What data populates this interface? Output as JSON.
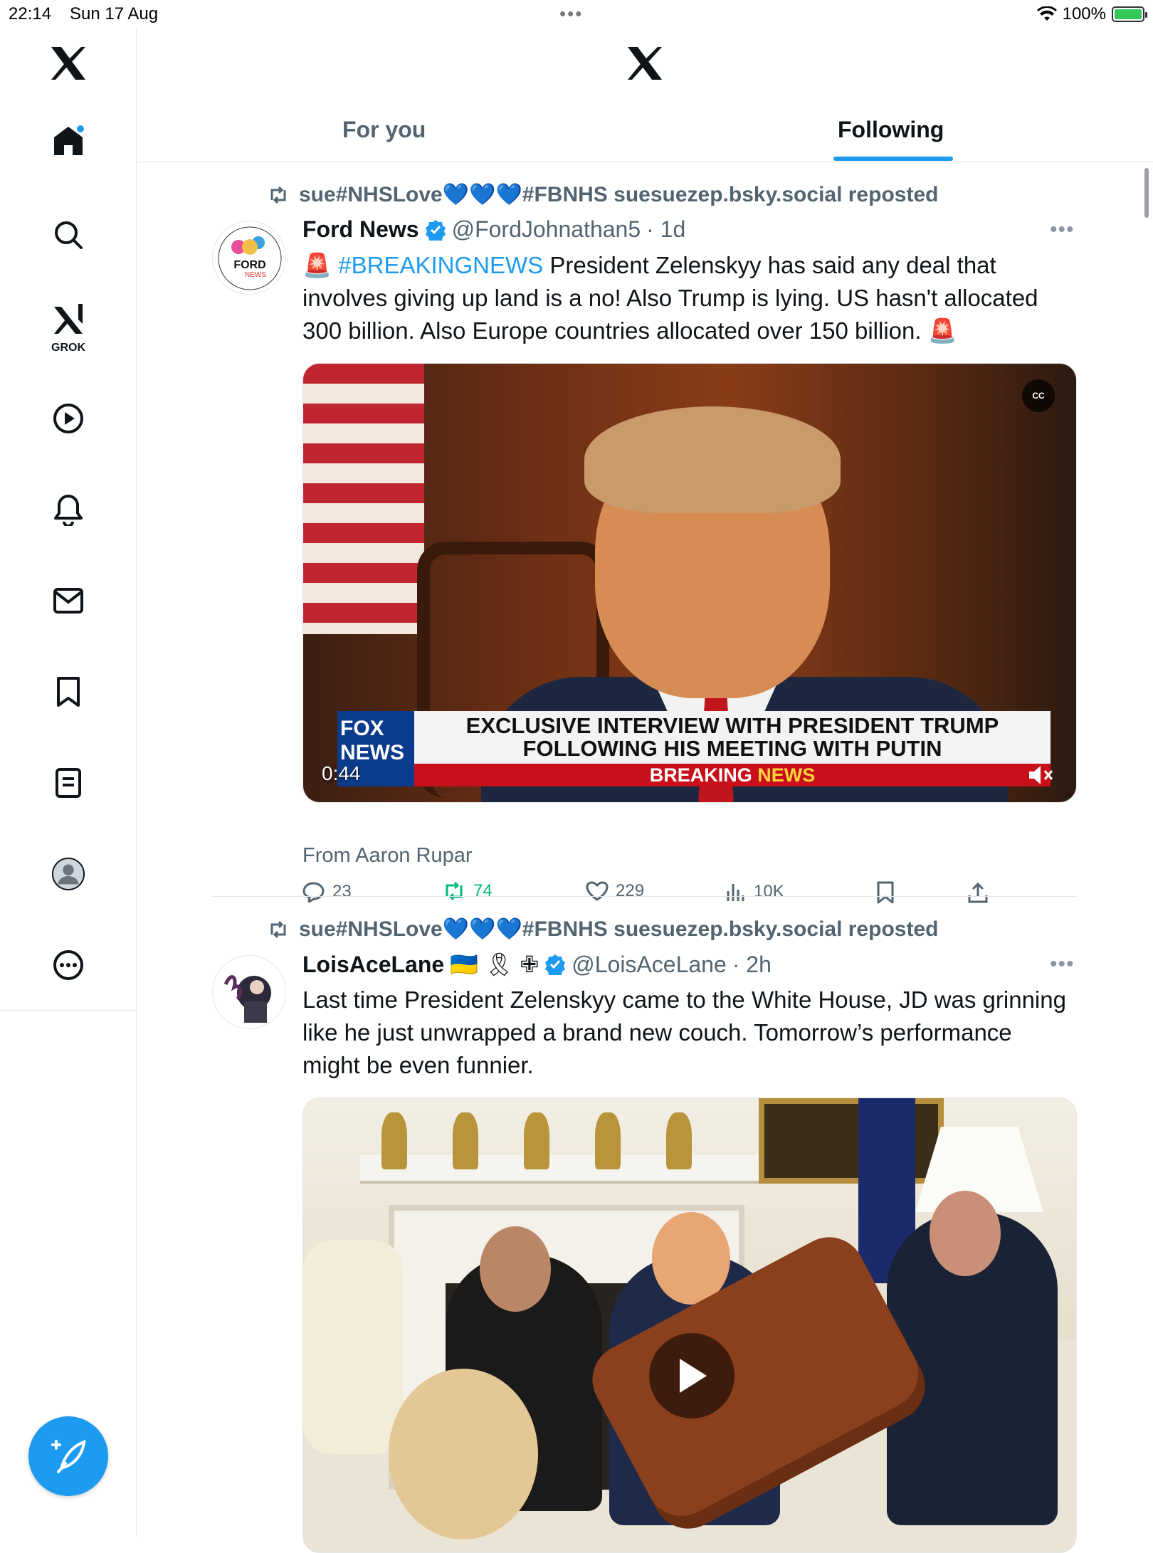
{
  "status_bar": {
    "time": "22:14",
    "date": "Sun 17 Aug",
    "battery": "100%"
  },
  "tabs": [
    {
      "label": "For you",
      "active": false
    },
    {
      "label": "Following",
      "active": true
    }
  ],
  "sidebar": {
    "grok_label": "GROK",
    "items": [
      "home-icon",
      "search-icon",
      "grok-icon",
      "video-icon",
      "notifications-bell-icon",
      "messages-envelope-icon",
      "bookmarks-icon",
      "lists-icon",
      "profile-avatar-icon",
      "more-icon"
    ]
  },
  "tweets": [
    {
      "repost_text": "sue#NHSLove💙💙💙#FBNHS suesuezep.bsky.social reposted",
      "name": "Ford News",
      "handle": "@FordJohnathan5",
      "time": "· 1d",
      "emoji_before": "🚨",
      "hashtag": "#BREAKINGNEWS",
      "text": " President Zelenskyy has said any deal that involves giving up land is a no! Also Trump is lying. US hasn't allocated 300 billion. Also Europe countries allocated over 150 billion. 🚨",
      "video": {
        "duration": "0:44",
        "chyron_logo": "FOX NEWS",
        "chyron_line1": "EXCLUSIVE INTERVIEW WITH PRESIDENT TRUMP",
        "chyron_line2": "FOLLOWING HIS MEETING WITH PUTIN",
        "chyron_bar_a": "BREAKING ",
        "chyron_bar_b": "NEWS",
        "cc_label": "CC"
      },
      "from": "From Aaron Rupar",
      "replies": "23",
      "reposts": "74",
      "likes": "229",
      "views": "10K"
    },
    {
      "repost_text": "sue#NHSLove💙💙💙#FBNHS suesuezep.bsky.social reposted",
      "name": "LoisAceLane",
      "name_emojis": "🇺🇦 🎗 ✙",
      "handle": "@LoisAceLane",
      "time": "· 2h",
      "text": "Last time President Zelenskyy came to the White House, JD was grinning like he just unwrapped a brand new couch. Tomorrow’s performance might be even funnier."
    }
  ],
  "colors": {
    "accent": "#1d9bf0",
    "repost_green": "#00ba7c",
    "secondary_text": "#536471"
  }
}
